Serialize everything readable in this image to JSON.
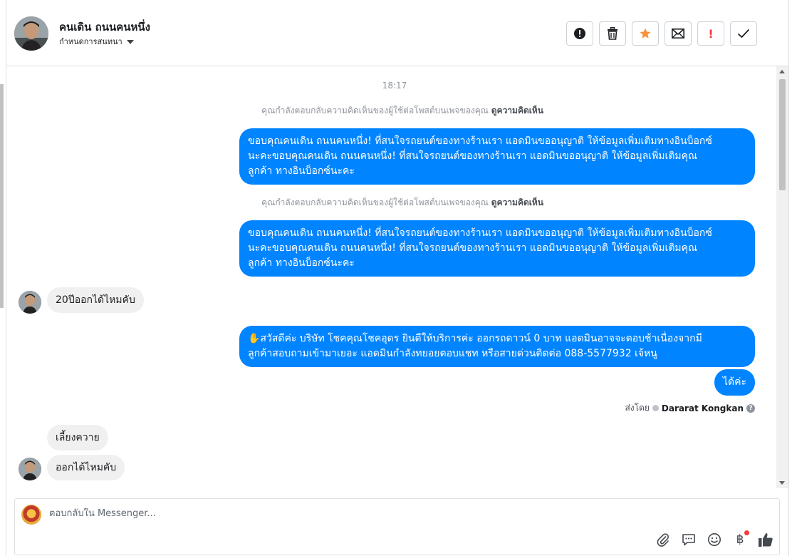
{
  "header": {
    "customer_name": "คนเดิน ถนนคนหนึ่ง",
    "assign_label": "กำหนดการสนทนา"
  },
  "toolbar": {
    "icons": [
      "alert-circle-icon",
      "trash-icon",
      "star-icon",
      "envelope-icon",
      "exclamation-icon",
      "checkmark-icon"
    ],
    "star_color": "#f7923a",
    "exclamation_color": "#fa383e",
    "exclamation_text": "!"
  },
  "chat": {
    "time": "18:17",
    "context_1": {
      "text": "คุณกำลังตอบกลับความคิดเห็นของผู้ใช้ต่อโพสต์บนเพจของคุณ",
      "link": "ดูความคิดเห็น"
    },
    "out_1_lines": [
      "ขอบคุณคนเดิน ถนนคนหนึ่ง! ที่สนใจรถยนต์ของทางร้านเรา แอดมินขออนุญาติ ให้ข้อมูลเพิ่มเติมทางอินบ็อกซ์",
      "นะคะขอบคุณคนเดิน ถนนคนหนึ่ง! ที่สนใจรถยนต์ของทางร้านเรา แอดมินขออนุญาติ ให้ข้อมูลเพิ่มเติมคุณ",
      "ลูกค้า ทางอินบ็อกซ์นะคะ"
    ],
    "context_2": {
      "text": "คุณกำลังตอบกลับความคิดเห็นของผู้ใช้ต่อโพสต์บนเพจของคุณ",
      "link": "ดูความคิดเห็น"
    },
    "out_2_lines": [
      "ขอบคุณคนเดิน ถนนคนหนึ่ง! ที่สนใจรถยนต์ของทางร้านเรา แอดมินขออนุญาติ ให้ข้อมูลเพิ่มเติมทางอินบ็อกซ์",
      "นะคะขอบคุณคนเดิน ถนนคนหนึ่ง! ที่สนใจรถยนต์ของทางร้านเรา แอดมินขออนุญาติ ให้ข้อมูลเพิ่มเติมคุณ",
      "ลูกค้า ทางอินบ็อกซ์นะคะ"
    ],
    "in_1": "20ปีออกได้ไหมคับ",
    "out_3_lines": [
      "✋สวัสดีค่ะ บริษัท โชคคุณโชคอุดร ยินดีให้บริการค่ะ ออกรถดาวน์ 0 บาท แอดมินอาจจะตอบช้าเนื่องจากมี",
      "ลูกค้าสอบถามเข้ามาเยอะ แอดมินกำลังทยอยตอบแชท หรือสายด่วนติดต่อ 088-5577932 เจ้หนู"
    ],
    "out_4": "ได้ค่ะ",
    "sent_by_label": "ส่งโดย",
    "sent_by_name": "Dararat Kongkan",
    "in_2": "เลี้ยงควาย",
    "in_3": "ออกได้ไหมคับ"
  },
  "composer": {
    "placeholder": "ตอบกลับใน Messenger...",
    "tools": [
      "paperclip-icon",
      "saved-reply-icon",
      "emoji-icon",
      "baht-icon",
      "like-icon"
    ],
    "baht_symbol": "฿"
  },
  "colors": {
    "outgoing_bubble": "#0084ff",
    "incoming_bubble": "#f1f0f0",
    "notification_dot": "#fa383e"
  }
}
